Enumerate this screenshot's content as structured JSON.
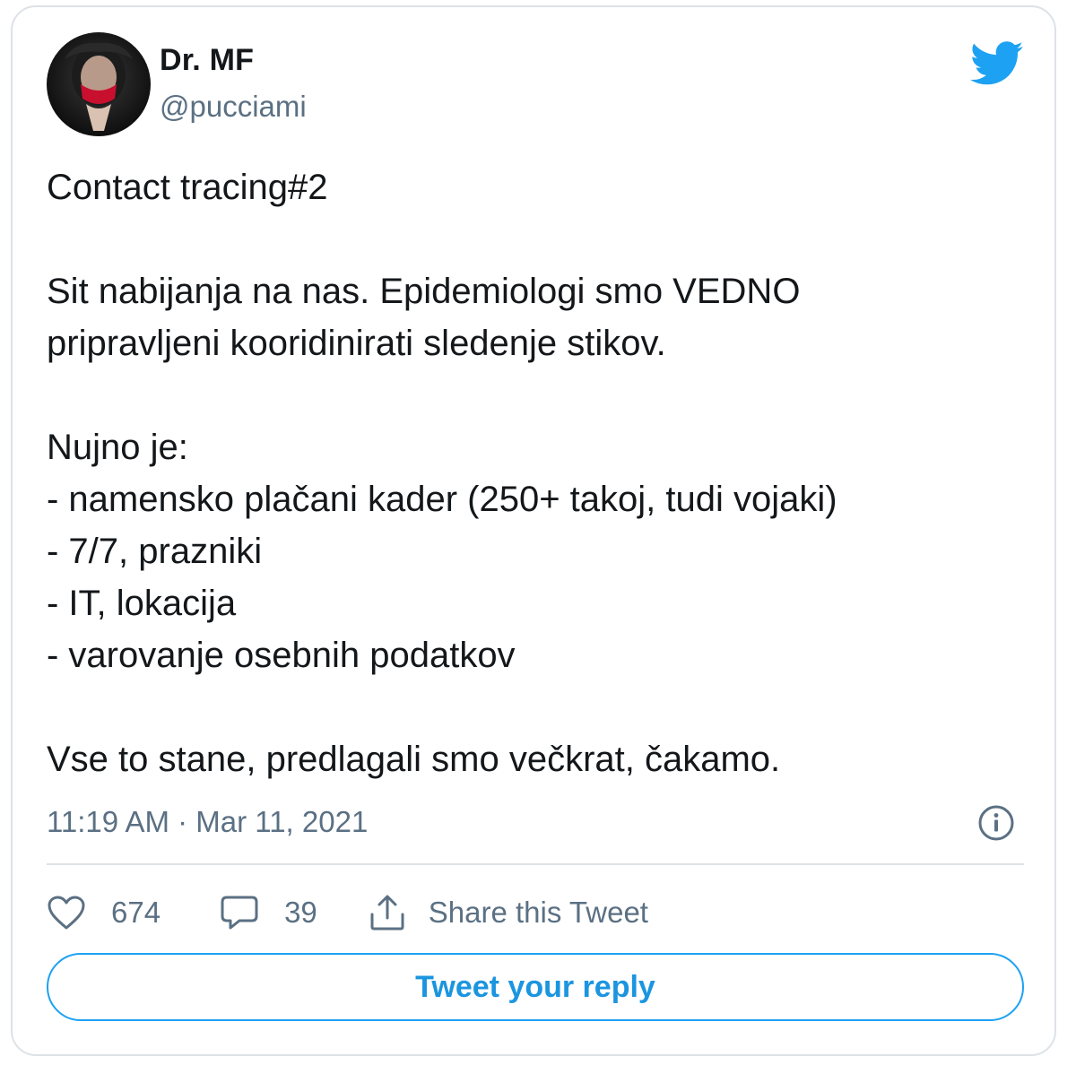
{
  "author": {
    "name": "Dr. MF",
    "handle": "@pucciami"
  },
  "tweet": {
    "lines": [
      "Contact tracing#2",
      "",
      "Sit nabijanja na nas. Epidemiologi smo VEDNO",
      "pripravljeni kooridinirati sledenje stikov.",
      "",
      "Nujno je:",
      "- namensko plačani kader (250+ takoj, tudi vojaki)",
      "- 7/7, prazniki",
      "- IT, lokacija",
      "- varovanje osebnih podatkov",
      "",
      "Vse to stane, predlagali smo večkrat, čakamo."
    ],
    "timestamp": "11:19 AM · Mar 11, 2021"
  },
  "actions": {
    "likes": "674",
    "replies": "39",
    "share_label": "Share this Tweet"
  },
  "reply_button": {
    "label": "Tweet your reply"
  },
  "icons": {
    "brand": "twitter-bird-icon",
    "info": "info-icon",
    "like": "heart-icon",
    "reply": "speech-bubble-icon",
    "share": "share-icon"
  },
  "colors": {
    "brand_blue": "#1da1f2",
    "secondary_text": "#5b7083",
    "border": "#dde2e6"
  }
}
